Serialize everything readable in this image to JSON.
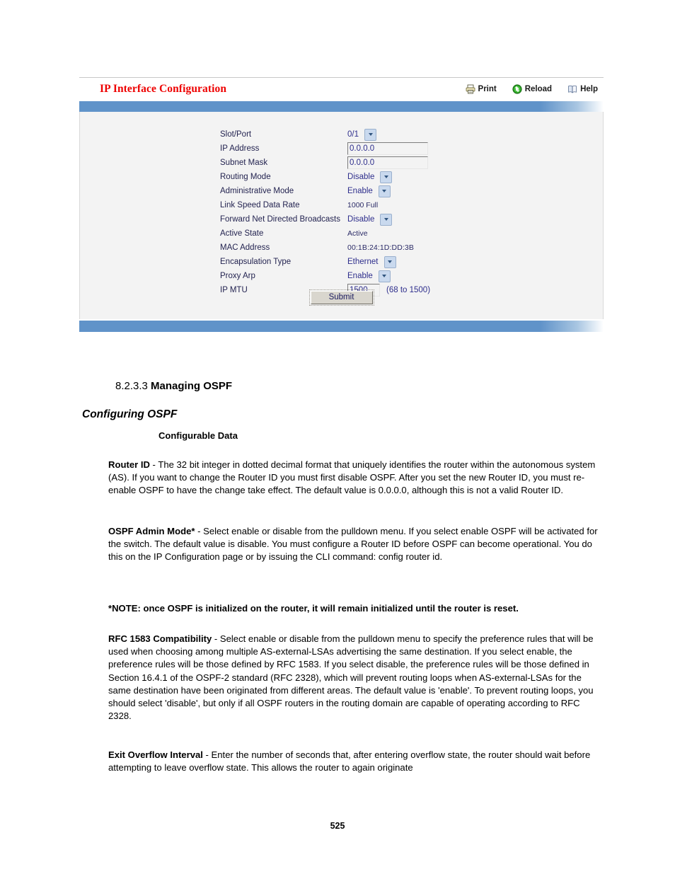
{
  "screenshot": {
    "title": "IP Interface Configuration",
    "title_color": "#ee0000",
    "accent_bar_color": "#6093c9",
    "toolbar": [
      {
        "label": "Print",
        "icon": "printer-icon"
      },
      {
        "label": "Reload",
        "icon": "reload-icon"
      },
      {
        "label": "Help",
        "icon": "help-book-icon"
      }
    ],
    "form": {
      "rows": [
        {
          "label": "Slot/Port",
          "type": "select",
          "value": "0/1"
        },
        {
          "label": "IP Address",
          "type": "text",
          "value": "0.0.0.0"
        },
        {
          "label": "Subnet Mask",
          "type": "text",
          "value": "0.0.0.0"
        },
        {
          "label": "Routing Mode",
          "type": "select",
          "value": "Disable"
        },
        {
          "label": "Administrative Mode",
          "type": "select",
          "value": "Enable"
        },
        {
          "label": "Link Speed Data Rate",
          "type": "static",
          "value": "1000 Full"
        },
        {
          "label": "Forward Net Directed Broadcasts",
          "type": "select",
          "value": "Disable"
        },
        {
          "label": "Active State",
          "type": "static",
          "value": "Active"
        },
        {
          "label": "MAC Address",
          "type": "static",
          "value": "00:1B:24:1D:DD:3B"
        },
        {
          "label": "Encapsulation Type",
          "type": "select",
          "value": "Ethernet"
        },
        {
          "label": "Proxy Arp",
          "type": "select",
          "value": "Enable"
        },
        {
          "label": "IP MTU",
          "type": "text",
          "value": "1500",
          "hint": "(68 to 1500)"
        }
      ],
      "submit_label": "Submit"
    }
  },
  "document": {
    "section_number": "8.2.3.3",
    "section_title": "Managing OSPF",
    "subsection_title": "Configuring OSPF",
    "group_heading": "Configurable Data",
    "paragraphs": {
      "router_id_term": "Router ID",
      "router_id_body": " - The 32 bit integer in dotted decimal format that uniquely identifies the router within the autonomous system (AS). If you want to change the Router ID you must first disable OSPF. After you set the new Router ID, you must re-enable OSPF to have the change take effect. The default value is 0.0.0.0, although this is not a valid Router ID.",
      "admin_mode_term": "OSPF Admin Mode*",
      "admin_mode_body": " - Select enable or disable from the pulldown menu. If you select enable OSPF will be activated for the switch. The default value is disable. You must configure a Router ID before OSPF can become operational. You do this on the IP Configuration page or by issuing the CLI command: config router id.",
      "note": "*NOTE: once OSPF is initialized on the router, it will remain initialized until the router is reset.",
      "rfc1583_term": "RFC 1583 Compatibility",
      "rfc1583_body": " - Select enable or disable from the pulldown menu to specify the preference rules that will be used when choosing among multiple AS-external-LSAs advertising the same destination. If you select enable, the preference rules will be those defined by RFC 1583. If you select disable, the preference rules will be those defined in Section 16.4.1 of the OSPF-2 standard (RFC 2328), which will prevent routing loops when AS-external-LSAs for the same destination have been originated from different areas. The default value is 'enable'. To prevent routing loops, you should select 'disable', but only if all OSPF routers in the routing domain are capable of operating according to RFC 2328.",
      "exit_overflow_term": "Exit Overflow Interval",
      "exit_overflow_body": " - Enter the number of seconds that, after entering overflow state, the router should wait before attempting to leave overflow state. This allows the router to again originate"
    },
    "page_number": "525"
  }
}
